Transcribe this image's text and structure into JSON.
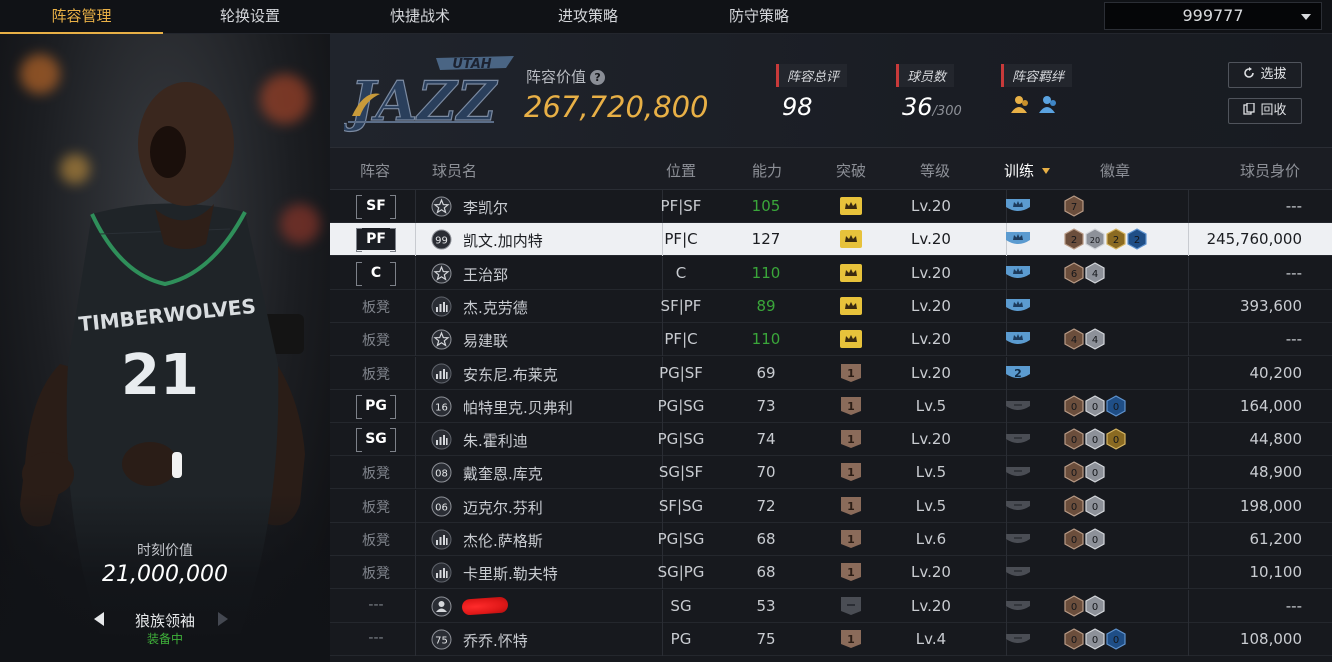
{
  "tabs": [
    "阵容管理",
    "轮换设置",
    "快捷战术",
    "进攻策略",
    "防守策略"
  ],
  "active_tab": 0,
  "currency": "999777",
  "left_panel": {
    "moment_label": "时刻价值",
    "moment_value": "21,000,000",
    "skin_name": "狼族领袖",
    "skin_status": "装备中"
  },
  "team": {
    "logo_text": "UTAH JAZZ",
    "value_label": "阵容价值",
    "value": "267,720,800",
    "rating_label": "阵容总评",
    "rating": "98",
    "players_label": "球员数",
    "players": "36",
    "players_max": "/300",
    "bond_label": "阵容羁绊",
    "select_btn": "选拔",
    "recycle_btn": "回收"
  },
  "columns": [
    "阵容",
    "球员名",
    "位置",
    "能力",
    "突破",
    "等级",
    "训练",
    "徽章",
    "球员身价"
  ],
  "rows": [
    {
      "lineup": "SF",
      "lineup_type": "starter",
      "tier": "star",
      "name": "李凯尔",
      "pos": "PF|SF",
      "ability": "105",
      "ability_green": true,
      "break": "gold",
      "level": "Lv.20",
      "train": "blue",
      "badges": [
        {
          "n": "7",
          "c": "brown"
        }
      ],
      "price": "---"
    },
    {
      "lineup": "PF",
      "lineup_type": "starter",
      "tier": "99",
      "name": "凯文.加内特",
      "pos": "PF|C",
      "ability": "127",
      "ability_green": false,
      "break": "gold",
      "level": "Lv.20",
      "train": "blue",
      "badges": [
        {
          "n": "2",
          "c": "brown"
        },
        {
          "n": "20",
          "c": "silver"
        },
        {
          "n": "2",
          "c": "gold"
        },
        {
          "n": "2",
          "c": "blue"
        }
      ],
      "price": "245,760,000"
    },
    {
      "lineup": "C",
      "lineup_type": "starter",
      "tier": "star",
      "name": "王治郅",
      "pos": "C",
      "ability": "110",
      "ability_green": true,
      "break": "gold",
      "level": "Lv.20",
      "train": "blue",
      "badges": [
        {
          "n": "6",
          "c": "brown"
        },
        {
          "n": "4",
          "c": "silver"
        }
      ],
      "price": "---"
    },
    {
      "lineup": "板凳",
      "lineup_type": "bench",
      "tier": "bars",
      "name": "杰.克劳德",
      "pos": "SF|PF",
      "ability": "89",
      "ability_green": true,
      "break": "gold",
      "level": "Lv.20",
      "train": "blue",
      "badges": [],
      "price": "393,600"
    },
    {
      "lineup": "板凳",
      "lineup_type": "bench",
      "tier": "star",
      "name": "易建联",
      "pos": "PF|C",
      "ability": "110",
      "ability_green": true,
      "break": "gold",
      "level": "Lv.20",
      "train": "blue",
      "badges": [
        {
          "n": "4",
          "c": "brown"
        },
        {
          "n": "4",
          "c": "silver"
        }
      ],
      "price": "---"
    },
    {
      "lineup": "板凳",
      "lineup_type": "bench",
      "tier": "bars",
      "name": "安东尼.布莱克",
      "pos": "PG|SF",
      "ability": "69",
      "ability_green": false,
      "break": "bronze",
      "level": "Lv.20",
      "train": "blue2",
      "badges": [],
      "price": "40,200"
    },
    {
      "lineup": "PG",
      "lineup_type": "starter",
      "tier": "16",
      "name": "帕特里克.贝弗利",
      "pos": "PG|SG",
      "ability": "73",
      "ability_green": false,
      "break": "bronze",
      "level": "Lv.5",
      "train": "grey",
      "badges": [
        {
          "n": "0",
          "c": "brown"
        },
        {
          "n": "0",
          "c": "silver"
        },
        {
          "n": "0",
          "c": "blue"
        }
      ],
      "price": "164,000"
    },
    {
      "lineup": "SG",
      "lineup_type": "starter",
      "tier": "bars",
      "name": "朱.霍利迪",
      "pos": "PG|SG",
      "ability": "74",
      "ability_green": false,
      "break": "bronze",
      "level": "Lv.20",
      "train": "grey",
      "badges": [
        {
          "n": "0",
          "c": "brown"
        },
        {
          "n": "0",
          "c": "silver"
        },
        {
          "n": "0",
          "c": "gold"
        }
      ],
      "price": "44,800"
    },
    {
      "lineup": "板凳",
      "lineup_type": "bench",
      "tier": "08",
      "name": "戴奎恩.库克",
      "pos": "SG|SF",
      "ability": "70",
      "ability_green": false,
      "break": "bronze",
      "level": "Lv.5",
      "train": "grey",
      "badges": [
        {
          "n": "0",
          "c": "brown"
        },
        {
          "n": "0",
          "c": "silver"
        }
      ],
      "price": "48,900"
    },
    {
      "lineup": "板凳",
      "lineup_type": "bench",
      "tier": "06",
      "name": "迈克尔.芬利",
      "pos": "SF|SG",
      "ability": "72",
      "ability_green": false,
      "break": "bronze",
      "level": "Lv.5",
      "train": "grey",
      "badges": [
        {
          "n": "0",
          "c": "brown"
        },
        {
          "n": "0",
          "c": "silver"
        }
      ],
      "price": "198,000"
    },
    {
      "lineup": "板凳",
      "lineup_type": "bench",
      "tier": "bars",
      "name": "杰伦.萨格斯",
      "pos": "PG|SG",
      "ability": "68",
      "ability_green": false,
      "break": "bronze",
      "level": "Lv.6",
      "train": "grey",
      "badges": [
        {
          "n": "0",
          "c": "brown"
        },
        {
          "n": "0",
          "c": "silver"
        }
      ],
      "price": "61,200"
    },
    {
      "lineup": "板凳",
      "lineup_type": "bench",
      "tier": "bars",
      "name": "卡里斯.勒夫特",
      "pos": "SG|PG",
      "ability": "68",
      "ability_green": false,
      "break": "bronze",
      "level": "Lv.20",
      "train": "grey",
      "badges": [],
      "price": "10,100"
    },
    {
      "lineup": "---",
      "lineup_type": "none",
      "tier": "person",
      "name": "",
      "pos": "SG",
      "ability": "53",
      "ability_green": false,
      "break": "grey",
      "level": "Lv.20",
      "train": "grey",
      "badges": [
        {
          "n": "0",
          "c": "brown"
        },
        {
          "n": "0",
          "c": "silver"
        }
      ],
      "price": "---",
      "redacted": true
    },
    {
      "lineup": "---",
      "lineup_type": "none",
      "tier": "75",
      "name": "乔乔.怀特",
      "pos": "PG",
      "ability": "75",
      "ability_green": false,
      "break": "bronze",
      "level": "Lv.4",
      "train": "grey",
      "badges": [
        {
          "n": "0",
          "c": "brown"
        },
        {
          "n": "0",
          "c": "silver"
        },
        {
          "n": "0",
          "c": "blue"
        }
      ],
      "price": "108,000"
    }
  ]
}
